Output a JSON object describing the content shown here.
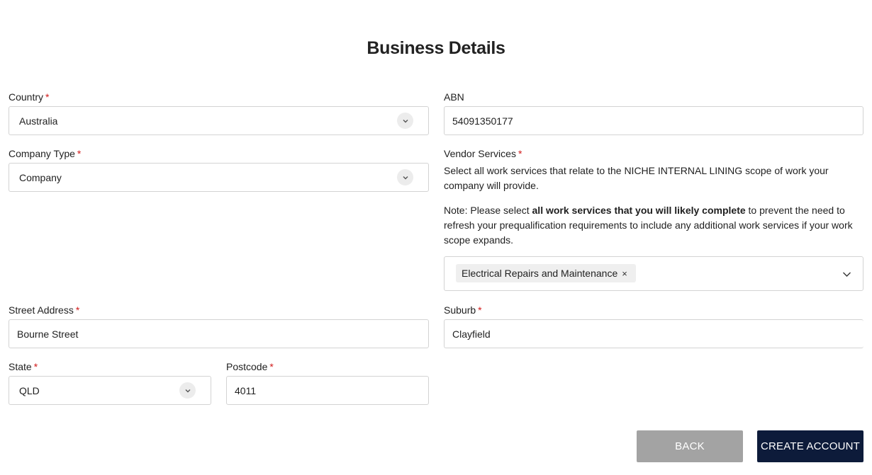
{
  "page": {
    "title": "Business Details"
  },
  "required_marker": "*",
  "form": {
    "country": {
      "label": "Country",
      "value": "Australia"
    },
    "abn": {
      "label": "ABN",
      "value": "54091350177"
    },
    "company_type": {
      "label": "Company Type",
      "value": "Company"
    },
    "vendor_services": {
      "label": "Vendor Services",
      "description": "Select all work services that relate to the NICHE INTERNAL LINING scope of work your company will provide.",
      "note_prefix": "Note: Please select ",
      "note_bold": "all work services that you will likely complete",
      "note_suffix": " to prevent the need to refresh your prequalification requirements to include any additional work services if your work scope expands.",
      "selected": [
        {
          "label": "Electrical Repairs and Maintenance",
          "remove": "×"
        }
      ]
    },
    "street_address": {
      "label": "Street Address",
      "value": "Bourne Street"
    },
    "suburb": {
      "label": "Suburb",
      "value": "Clayfield"
    },
    "state": {
      "label": "State",
      "value": "QLD"
    },
    "postcode": {
      "label": "Postcode",
      "value": "4011"
    }
  },
  "buttons": {
    "back": "BACK",
    "create": "CREATE ACCOUNT"
  },
  "colors": {
    "primary": "#0d1b3a",
    "secondary": "#a3a3a3",
    "required": "#d11a1a"
  }
}
